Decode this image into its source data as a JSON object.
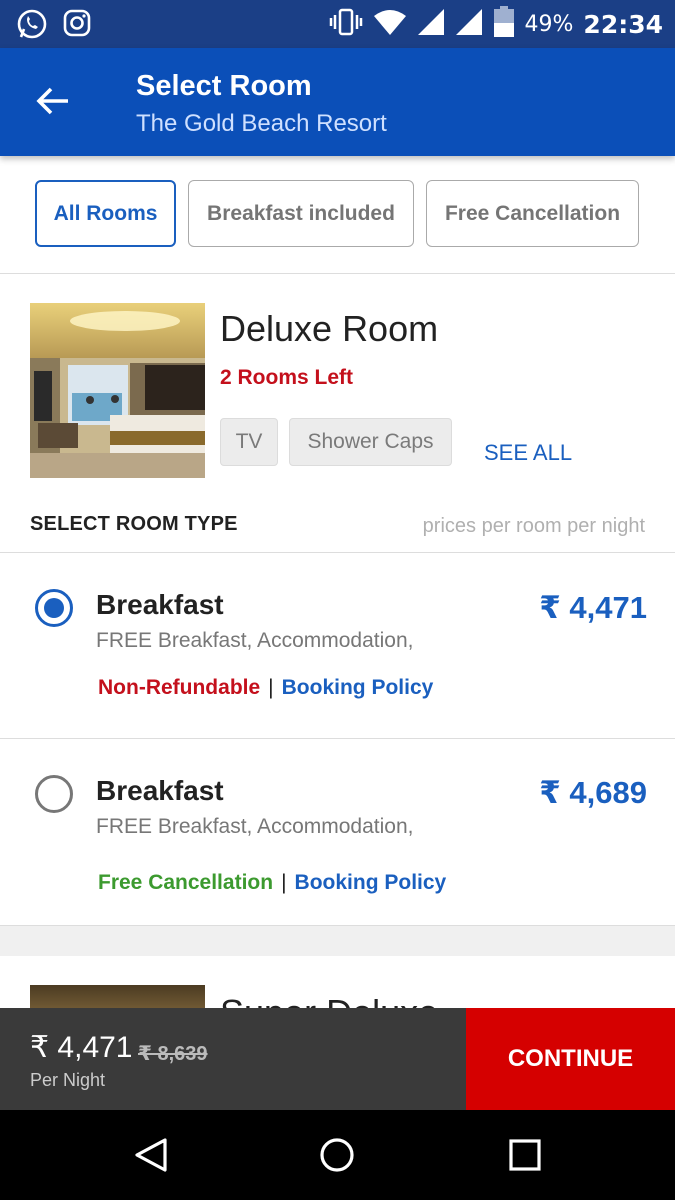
{
  "status_bar": {
    "battery_pct": "49%",
    "time": "22:34"
  },
  "header": {
    "title": "Select Room",
    "subtitle": "The Gold Beach Resort"
  },
  "filters": [
    {
      "label": "All Rooms",
      "active": true
    },
    {
      "label": "Breakfast included",
      "active": false
    },
    {
      "label": "Free Cancellation",
      "active": false
    }
  ],
  "room": {
    "name": "Deluxe Room",
    "availability": "2 Rooms Left",
    "amenities": [
      "TV",
      "Shower Caps"
    ],
    "see_all": "SEE ALL"
  },
  "room_type_section": {
    "label": "SELECT ROOM TYPE",
    "hint": "prices per room per night"
  },
  "options": [
    {
      "title": "Breakfast",
      "description": "FREE Breakfast, Accommodation,",
      "price": "₹ 4,471",
      "policy_tag": "Non-Refundable",
      "policy_link": "Booking Policy",
      "selected": true
    },
    {
      "title": "Breakfast",
      "description": "FREE Breakfast, Accommodation,",
      "price": "₹ 4,689",
      "policy_tag": "Free Cancellation",
      "policy_link": "Booking Policy",
      "selected": false
    }
  ],
  "next_room": {
    "name": "Super Deluxe"
  },
  "bottom_bar": {
    "price": "₹ 4,471",
    "old_price": "₹ 8,639",
    "per_night": "Per Night",
    "cta": "CONTINUE"
  },
  "icons": {
    "status_left": [
      "whatsapp-icon",
      "instagram-icon"
    ],
    "status_right": [
      "vibrate-icon",
      "wifi-icon",
      "signal-icon",
      "signal-icon",
      "battery-icon"
    ],
    "nav": [
      "back-triangle-icon",
      "home-circle-icon",
      "recents-square-icon"
    ]
  },
  "colors": {
    "primary": "#0b4fb8",
    "accent_red": "#d50000",
    "green": "#3c9a2f"
  }
}
